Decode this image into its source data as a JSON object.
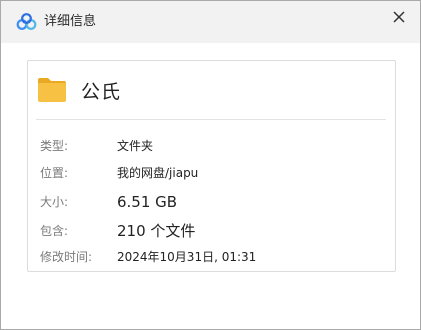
{
  "window": {
    "title": "详细信息",
    "app_icon": "baidu-netdisk-logo-icon",
    "close_icon": "close-icon",
    "close_glyph": "✕"
  },
  "file": {
    "icon": "folder-icon",
    "name": "公氏"
  },
  "details": {
    "type_label": "类型:",
    "type_value": "文件夹",
    "location_label": "位置:",
    "location_value": "我的网盘/jiapu",
    "size_label": "大小:",
    "size_value": "6.51 GB",
    "contains_label": "包含:",
    "contains_value": "210 个文件",
    "modified_label": "修改时间:",
    "modified_value": "2024年10月31日, 01:31"
  },
  "colors": {
    "folder": "#f7c244",
    "folder_tab": "#e9a923",
    "logo_blue": "#3a8ef6",
    "logo_teal": "#4fb7e6"
  }
}
